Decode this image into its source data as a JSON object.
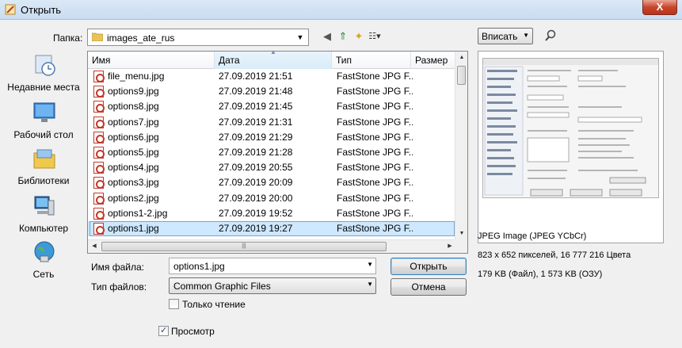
{
  "window": {
    "title": "Открыть",
    "close_glyph": "X"
  },
  "location": {
    "label": "Папка:",
    "folder": "images_ate_rus"
  },
  "places": [
    {
      "label": "Недавние места",
      "icon": "recent-places-icon"
    },
    {
      "label": "Рабочий стол",
      "icon": "desktop-icon"
    },
    {
      "label": "Библиотеки",
      "icon": "libraries-icon"
    },
    {
      "label": "Компьютер",
      "icon": "computer-icon"
    },
    {
      "label": "Сеть",
      "icon": "network-icon"
    }
  ],
  "columns": {
    "name": "Имя",
    "date": "Дата",
    "type": "Тип",
    "size": "Размер"
  },
  "files": [
    {
      "name": "file_menu.jpg",
      "date": "27.09.2019 21:51",
      "type": "FastStone JPG F..."
    },
    {
      "name": "options9.jpg",
      "date": "27.09.2019 21:48",
      "type": "FastStone JPG F..."
    },
    {
      "name": "options8.jpg",
      "date": "27.09.2019 21:45",
      "type": "FastStone JPG F..."
    },
    {
      "name": "options7.jpg",
      "date": "27.09.2019 21:31",
      "type": "FastStone JPG F..."
    },
    {
      "name": "options6.jpg",
      "date": "27.09.2019 21:29",
      "type": "FastStone JPG F..."
    },
    {
      "name": "options5.jpg",
      "date": "27.09.2019 21:28",
      "type": "FastStone JPG F..."
    },
    {
      "name": "options4.jpg",
      "date": "27.09.2019 20:55",
      "type": "FastStone JPG F..."
    },
    {
      "name": "options3.jpg",
      "date": "27.09.2019 20:09",
      "type": "FastStone JPG F..."
    },
    {
      "name": "options2.jpg",
      "date": "27.09.2019 20:00",
      "type": "FastStone JPG F..."
    },
    {
      "name": "options1-2.jpg",
      "date": "27.09.2019 19:52",
      "type": "FastStone JPG F..."
    },
    {
      "name": "options1.jpg",
      "date": "27.09.2019 19:27",
      "type": "FastStone JPG F...",
      "selected": true
    }
  ],
  "filename": {
    "label": "Имя файла:",
    "value": "options1.jpg"
  },
  "filetype": {
    "label": "Тип файлов:",
    "value": "Common Graphic Files"
  },
  "readonly": {
    "label": "Только чтение",
    "checked": false
  },
  "preview_toggle": {
    "label": "Просмотр",
    "checked": true
  },
  "buttons": {
    "open": "Открыть",
    "cancel": "Отмена"
  },
  "zoom": {
    "value": "Вписать"
  },
  "image_info": {
    "format": "JPEG Image (JPEG YCbCr)",
    "dimensions": "823 x 652 пикселей, 16 777 216 Цвета",
    "size": "179 KB (Файл), 1 573 KB (ОЗУ)"
  },
  "colors": {
    "selection": "#cde8ff",
    "accent": "#3c7fb1"
  }
}
